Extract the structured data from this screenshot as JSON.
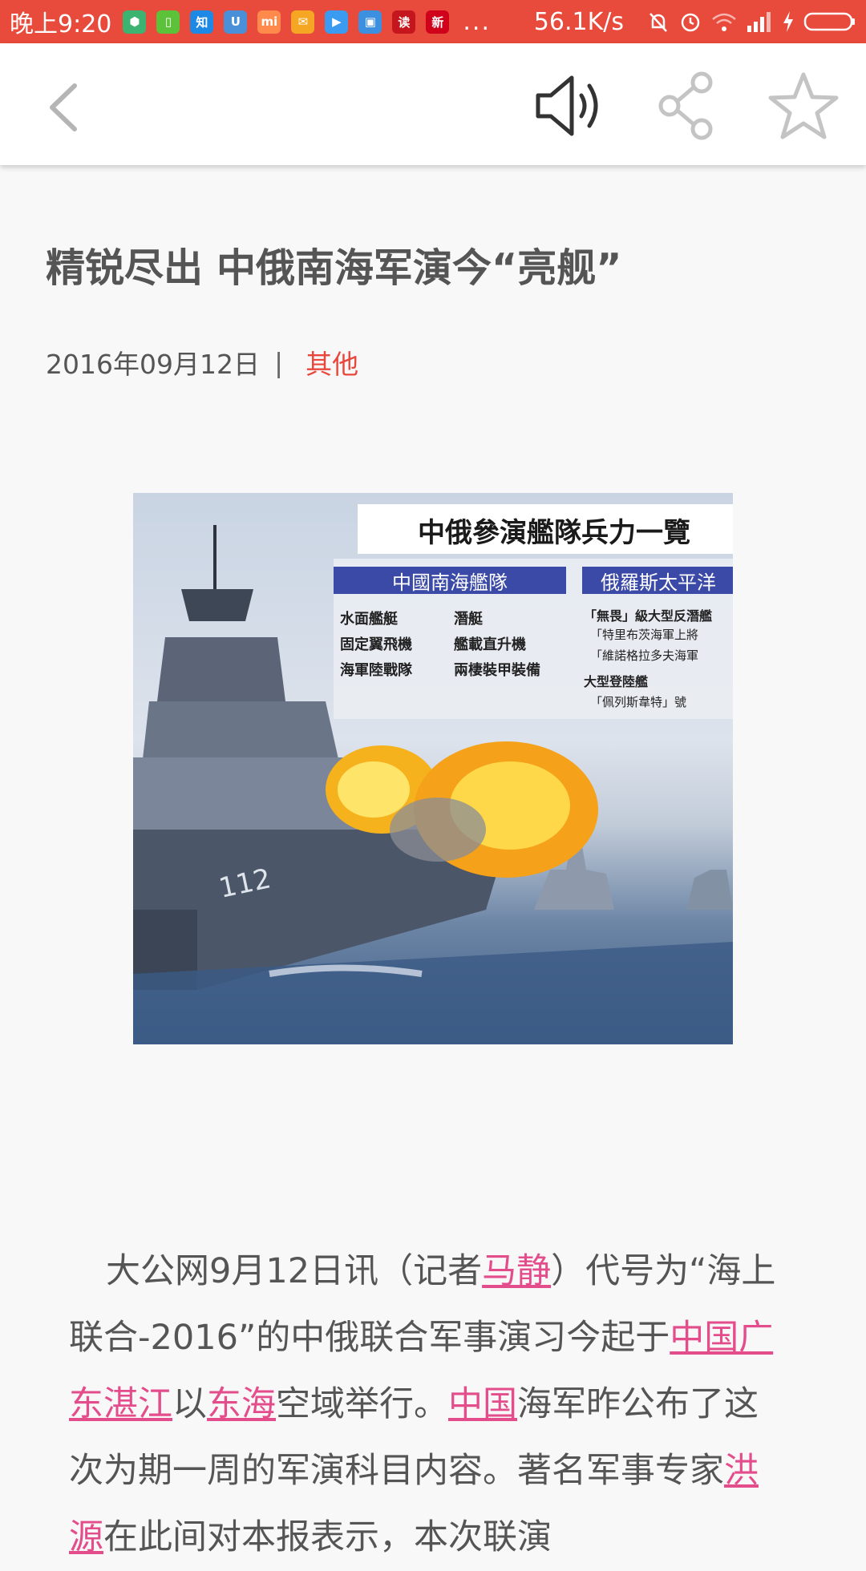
{
  "status_bar": {
    "time": "晚上9:20",
    "more": "...",
    "net_speed": "56.1K/s",
    "apps": [
      {
        "icon": "shield-app-icon",
        "color": "#3cb371",
        "glyph": "⬢"
      },
      {
        "icon": "green-app-icon",
        "color": "#5cc23a",
        "glyph": "▯"
      },
      {
        "icon": "zhihu-icon",
        "color": "#1e88e5",
        "glyph": "知"
      },
      {
        "icon": "u-app-icon",
        "color": "#4a90d9",
        "glyph": "U"
      },
      {
        "icon": "mi-app-icon",
        "color": "#ff8a4c",
        "glyph": "mi"
      },
      {
        "icon": "mail-icon",
        "color": "#f5a623",
        "glyph": "✉"
      },
      {
        "icon": "video-play-icon",
        "color": "#3a9bf0",
        "glyph": "▶"
      },
      {
        "icon": "package-app-icon",
        "color": "#3d8fe0",
        "glyph": "▣"
      },
      {
        "icon": "reading-app-icon",
        "color": "#c4161c",
        "glyph": "读"
      },
      {
        "icon": "news-app-icon",
        "color": "#d0021b",
        "glyph": "新"
      }
    ]
  },
  "toolbar": {
    "back_icon": "back-arrow-icon",
    "speaker_icon": "speaker-icon",
    "share_icon": "share-icon",
    "star_icon": "star-icon"
  },
  "article": {
    "title": "精锐尽出 中俄南海军演今“亮舰”",
    "date": "2016年09月12日",
    "separator": "|",
    "category": "其他",
    "image": {
      "banner": "中俄參演艦隊兵力一覽",
      "label_left": "中國南海艦隊",
      "label_right": "俄羅斯太平洋",
      "items_left": [
        "水面艦艇",
        "固定翼飛機",
        "海軍陸戰隊"
      ],
      "items_mid": [
        "潛艇",
        "艦載直升機",
        "兩棲裝甲裝備"
      ],
      "items_right": [
        "「無畏」級大型反潛艦",
        "「特里布茨海軍上將",
        "「維諾格拉多夫海軍",
        "大型登陸艦",
        "「佩列斯韋特」號"
      ],
      "hull_number": "112"
    },
    "body": {
      "p1_a": "大公网9月12日讯（记者",
      "link_reporter": "马静",
      "p1_b": "）代号为“海上联合-2016”的中俄联合军事演习今起于",
      "link_location": "中国广东湛江",
      "p1_c": "以",
      "link_east_sea": "东海",
      "p1_d": "空域举行。",
      "link_china": "中国",
      "p1_e": "海军昨公布了这次为期一周的军演科目内容。著名军事专家",
      "link_expert": "洪源",
      "p1_f": "在此间对本报表示，本次联演"
    },
    "colors": {
      "link": "#e44d8c",
      "category": "#e8473c",
      "status_bar": "#e84a3c"
    }
  }
}
